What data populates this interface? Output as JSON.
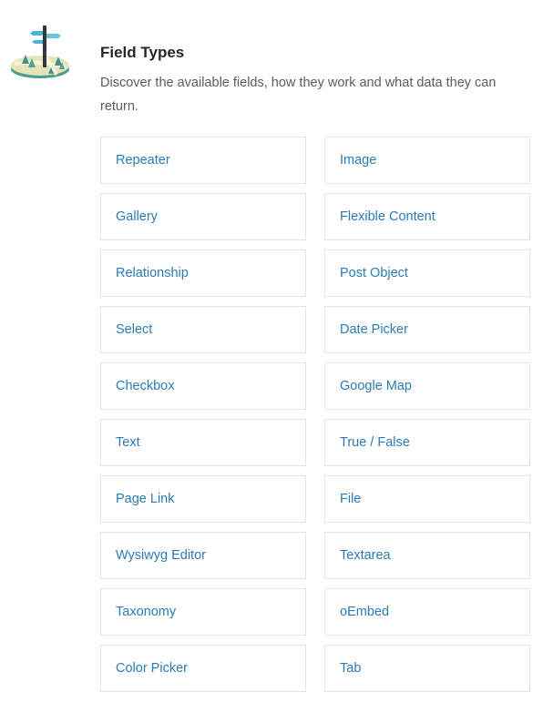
{
  "section": {
    "title": "Field Types",
    "description": "Discover the available fields, how they work and what data they can return.",
    "icon": "signpost-map-icon"
  },
  "colors": {
    "link": "#2a7bb5",
    "title": "#23282d",
    "text": "#555d66",
    "border": "#e5e5e5"
  },
  "fields": [
    {
      "label": "Repeater"
    },
    {
      "label": "Image"
    },
    {
      "label": "Gallery"
    },
    {
      "label": "Flexible Content"
    },
    {
      "label": "Relationship"
    },
    {
      "label": "Post Object"
    },
    {
      "label": "Select"
    },
    {
      "label": "Date Picker"
    },
    {
      "label": "Checkbox"
    },
    {
      "label": "Google Map"
    },
    {
      "label": "Text"
    },
    {
      "label": "True / False"
    },
    {
      "label": "Page Link"
    },
    {
      "label": "File"
    },
    {
      "label": "Wysiwyg Editor"
    },
    {
      "label": "Textarea"
    },
    {
      "label": "Taxonomy"
    },
    {
      "label": "oEmbed"
    },
    {
      "label": "Color Picker"
    },
    {
      "label": "Tab"
    }
  ]
}
